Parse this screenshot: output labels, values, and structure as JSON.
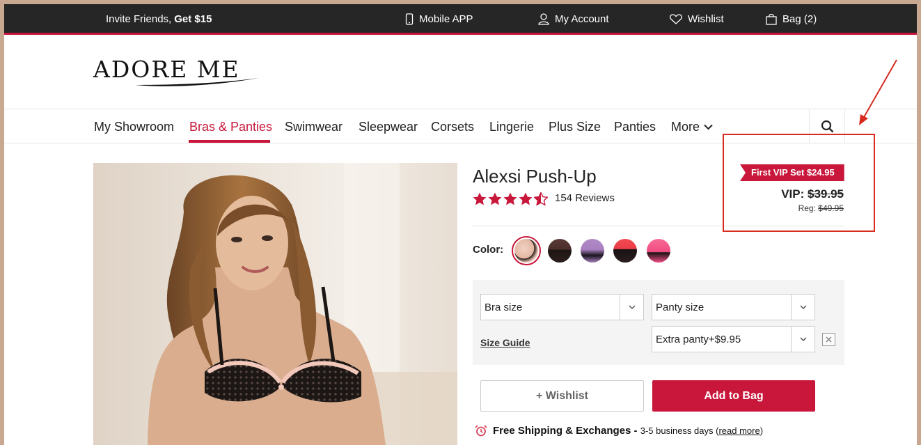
{
  "topbar": {
    "invite_prefix": "Invite Friends,",
    "invite_bold": "Get $15",
    "mobile_app": "Mobile APP",
    "my_account": "My Account",
    "wishlist": "Wishlist",
    "bag": "Bag (2)"
  },
  "brand": {
    "logo": "ADORE ME"
  },
  "nav": {
    "items": [
      "My Showroom",
      "Bras & Panties",
      "Swimwear",
      "Sleepwear",
      "Corsets",
      "Lingerie",
      "Plus Size",
      "Panties",
      "More"
    ],
    "active_index": 1
  },
  "product": {
    "title": "Alexsi Push-Up",
    "rating": 4.5,
    "rating_max": 5,
    "reviews": "154 Reviews",
    "vip_badge": "First VIP Set $24.95",
    "vip_label": "VIP:",
    "vip_price": "$39.95",
    "reg_label": "Reg:",
    "reg_price": "$49.95",
    "color_label": "Color:",
    "colors": [
      {
        "name": "blush-black-lace",
        "hex": "#e9c4b4",
        "selected": true
      },
      {
        "name": "brown",
        "hex": "#4a2e2a",
        "selected": false
      },
      {
        "name": "lilac-black",
        "hex": "#a97fc0",
        "selected": false
      },
      {
        "name": "red-black",
        "hex": "#ec3d48",
        "selected": false
      },
      {
        "name": "pink-black",
        "hex": "#f24d83",
        "selected": false
      }
    ]
  },
  "options": {
    "bra_size": "Bra size",
    "panty_size": "Panty size",
    "extra_panty": "Extra panty+$9.95",
    "size_guide": "Size Guide"
  },
  "actions": {
    "wishlist": "+ Wishlist",
    "add_to_bag": "Add to Bag"
  },
  "shipping": {
    "bold": "Free Shipping & Exchanges -",
    "detail": "3-5 business days (",
    "link": "read more",
    "close": ")"
  },
  "colors": {
    "accent": "#c8173b",
    "topbar": "#262626",
    "annotation": "#d62b1e"
  }
}
